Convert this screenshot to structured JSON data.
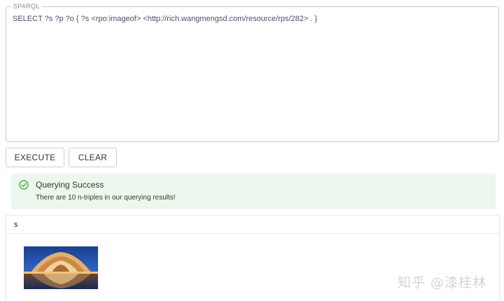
{
  "sparql": {
    "legend": "SPARQL",
    "query": "SELECT ?s ?p ?o { ?s <rpo:imageof> <http://rich.wangmengsd.com/resource/rps/282> . }"
  },
  "buttons": {
    "execute_label": "EXECUTE",
    "clear_label": "CLEAR"
  },
  "alert": {
    "title": "Querying Success",
    "message": "There are 10 n-triples in our querying results!",
    "color": "#4caf50"
  },
  "results": {
    "columns": [
      "s"
    ]
  },
  "watermark": "知乎 @漆桂林"
}
